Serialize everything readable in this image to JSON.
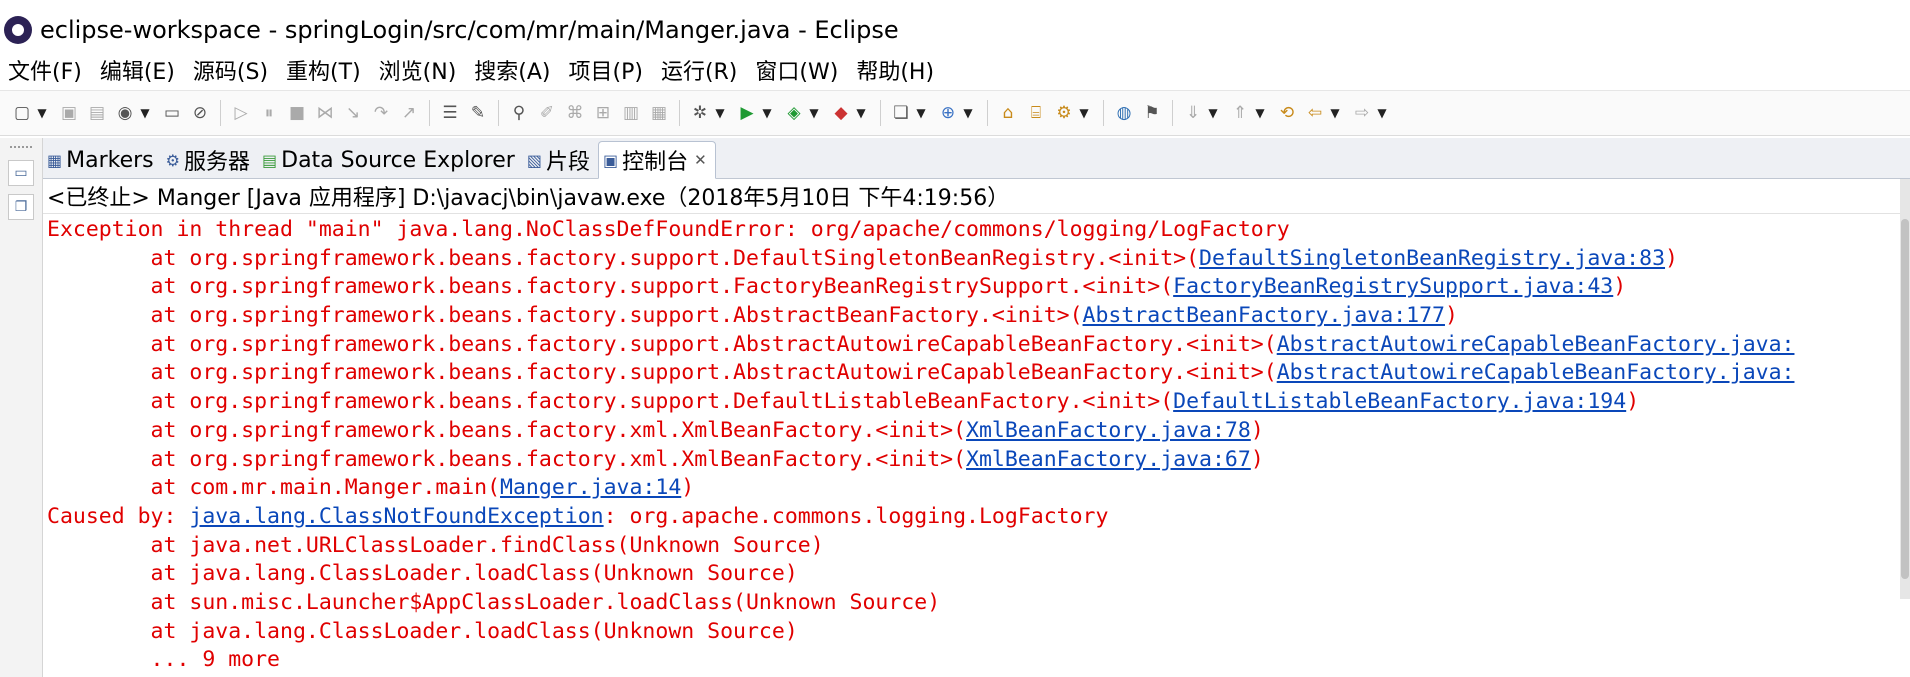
{
  "window": {
    "title": "eclipse-workspace - springLogin/src/com/mr/main/Manger.java - Eclipse"
  },
  "menu": [
    "文件(F)",
    "编辑(E)",
    "源码(S)",
    "重构(T)",
    "浏览(N)",
    "搜索(A)",
    "项目(P)",
    "运行(R)",
    "窗口(W)",
    "帮助(H)"
  ],
  "tabs": [
    {
      "label": "Markers",
      "icon": "markers-icon",
      "glyph": "▦"
    },
    {
      "label": "服务器",
      "icon": "servers-icon",
      "glyph": "⚙"
    },
    {
      "label": "Data Source Explorer",
      "icon": "data-source-icon",
      "glyph": "▤"
    },
    {
      "label": "片段",
      "icon": "snippets-icon",
      "glyph": "▧"
    },
    {
      "label": "控制台",
      "icon": "console-icon",
      "glyph": "▣"
    }
  ],
  "active_tab": "控制台",
  "console": {
    "header": "<已终止> Manger [Java 应用程序] D:\\javacj\\bin\\javaw.exe（2018年5月10日 下午4:19:56）",
    "lines": [
      {
        "pre": "Exception in thread \"main\" java.lang.NoClassDefFoundError: org/apache/commons/logging/LogFactory",
        "link": "",
        "post": ""
      },
      {
        "pre": "\tat org.springframework.beans.factory.support.DefaultSingletonBeanRegistry.<init>(",
        "link": "DefaultSingletonBeanRegistry.java:83",
        "post": ")"
      },
      {
        "pre": "\tat org.springframework.beans.factory.support.FactoryBeanRegistrySupport.<init>(",
        "link": "FactoryBeanRegistrySupport.java:43",
        "post": ")"
      },
      {
        "pre": "\tat org.springframework.beans.factory.support.AbstractBeanFactory.<init>(",
        "link": "AbstractBeanFactory.java:177",
        "post": ")"
      },
      {
        "pre": "\tat org.springframework.beans.factory.support.AbstractAutowireCapableBeanFactory.<init>(",
        "link": "AbstractAutowireCapableBeanFactory.java:",
        "post": ""
      },
      {
        "pre": "\tat org.springframework.beans.factory.support.AbstractAutowireCapableBeanFactory.<init>(",
        "link": "AbstractAutowireCapableBeanFactory.java:",
        "post": ""
      },
      {
        "pre": "\tat org.springframework.beans.factory.support.DefaultListableBeanFactory.<init>(",
        "link": "DefaultListableBeanFactory.java:194",
        "post": ")"
      },
      {
        "pre": "\tat org.springframework.beans.factory.xml.XmlBeanFactory.<init>(",
        "link": "XmlBeanFactory.java:78",
        "post": ")"
      },
      {
        "pre": "\tat org.springframework.beans.factory.xml.XmlBeanFactory.<init>(",
        "link": "XmlBeanFactory.java:67",
        "post": ")"
      },
      {
        "pre": "\tat com.mr.main.Manger.main(",
        "link": "Manger.java:14",
        "post": ")"
      },
      {
        "pre": "Caused by: ",
        "link": "java.lang.ClassNotFoundException",
        "post": ": org.apache.commons.logging.LogFactory"
      },
      {
        "pre": "\tat java.net.URLClassLoader.findClass(Unknown Source)",
        "link": "",
        "post": ""
      },
      {
        "pre": "\tat java.lang.ClassLoader.loadClass(Unknown Source)",
        "link": "",
        "post": ""
      },
      {
        "pre": "\tat sun.misc.Launcher$AppClassLoader.loadClass(Unknown Source)",
        "link": "",
        "post": ""
      },
      {
        "pre": "\tat java.lang.ClassLoader.loadClass(Unknown Source)",
        "link": "",
        "post": ""
      },
      {
        "pre": "\t... 9 more",
        "link": "",
        "post": ""
      }
    ]
  },
  "colors": {
    "error": "#e00000",
    "link": "#0a47b9"
  }
}
